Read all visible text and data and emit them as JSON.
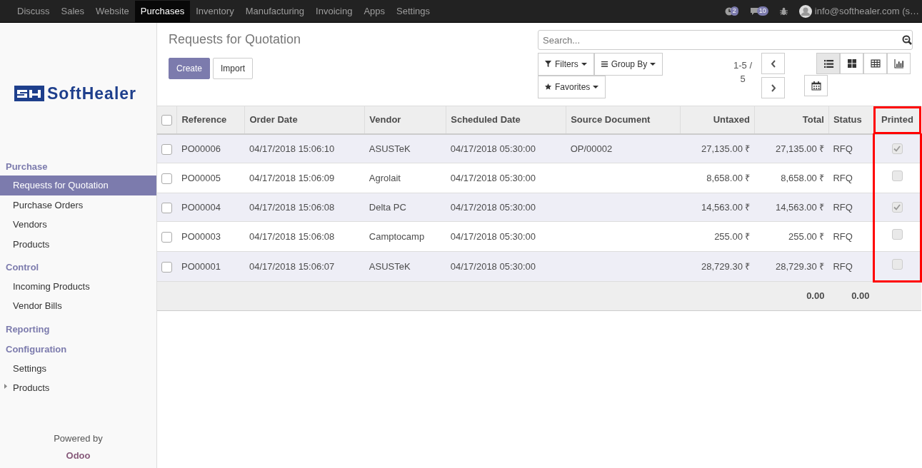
{
  "top_menu": [
    {
      "label": "Discuss",
      "selected": false
    },
    {
      "label": "Sales",
      "selected": false
    },
    {
      "label": "Website",
      "selected": false
    },
    {
      "label": "Purchases",
      "selected": true
    },
    {
      "label": "Inventory",
      "selected": false
    },
    {
      "label": "Manufacturing",
      "selected": false
    },
    {
      "label": "Invoicing",
      "selected": false
    },
    {
      "label": "Apps",
      "selected": false
    },
    {
      "label": "Settings",
      "selected": false
    }
  ],
  "systray": {
    "activities_count": "2",
    "messages_count": "10",
    "user": "info@softhealer.com (s…"
  },
  "sidebar": {
    "logo_text": "SoftHealer",
    "sections": [
      {
        "title": "Purchase",
        "items": [
          {
            "label": "Requests for Quotation",
            "selected": true
          },
          {
            "label": "Purchase Orders",
            "selected": false
          },
          {
            "label": "Vendors",
            "selected": false
          },
          {
            "label": "Products",
            "selected": false
          }
        ]
      },
      {
        "title": "Control",
        "items": [
          {
            "label": "Incoming Products",
            "selected": false
          },
          {
            "label": "Vendor Bills",
            "selected": false
          }
        ]
      },
      {
        "title": "Reporting"
      },
      {
        "title": "Configuration",
        "items": [
          {
            "label": "Settings",
            "selected": false
          },
          {
            "label": "Products",
            "selected": false,
            "expandable": true
          }
        ]
      }
    ],
    "footer": {
      "prefix": "Powered by",
      "brand": "Odoo"
    }
  },
  "control_panel": {
    "title": "Requests for Quotation",
    "buttons": [
      {
        "label": "Create",
        "kind": "primary"
      },
      {
        "label": "Import",
        "kind": "secondary"
      }
    ],
    "search": {
      "placeholder": "Search..."
    },
    "filters": [
      {
        "label": "Filters",
        "kind": "filter"
      },
      {
        "label": "Group By",
        "kind": "group"
      },
      {
        "label": "Favorites",
        "kind": "star"
      }
    ],
    "pager": "1-5 / 5",
    "views": [
      {
        "kind": "list",
        "selected": true
      },
      {
        "kind": "kanban",
        "selected": false
      },
      {
        "kind": "pivot",
        "selected": false
      },
      {
        "kind": "graph",
        "selected": false
      },
      {
        "kind": "calendar",
        "selected": false
      }
    ]
  },
  "table": {
    "all_selected": false,
    "columns": [
      {
        "label": "Reference",
        "kind": "text",
        "highlighted": false
      },
      {
        "label": "Order Date",
        "kind": "text",
        "highlighted": false
      },
      {
        "label": "Vendor",
        "kind": "text",
        "highlighted": false
      },
      {
        "label": "Scheduled Date",
        "kind": "text",
        "highlighted": false
      },
      {
        "label": "Source Document",
        "kind": "text",
        "highlighted": false
      },
      {
        "label": "Untaxed",
        "kind": "amount",
        "highlighted": false
      },
      {
        "label": "Total",
        "kind": "amount",
        "highlighted": false
      },
      {
        "label": "Status",
        "kind": "text",
        "highlighted": false
      },
      {
        "label": "Printed",
        "kind": "flag",
        "highlighted": true
      }
    ],
    "rows": [
      {
        "cells": [
          "PO00006",
          "04/17/2018 15:06:10",
          "ASUSTeK",
          "04/17/2018 05:30:00",
          "OP/00002",
          "27,135.00 ₹",
          "27,135.00 ₹",
          "RFQ"
        ],
        "printed": true,
        "selected": false
      },
      {
        "cells": [
          "PO00005",
          "04/17/2018 15:06:09",
          "Agrolait",
          "04/17/2018 05:30:00",
          "",
          "8,658.00 ₹",
          "8,658.00 ₹",
          "RFQ"
        ],
        "printed": false,
        "selected": false
      },
      {
        "cells": [
          "PO00004",
          "04/17/2018 15:06:08",
          "Delta PC",
          "04/17/2018 05:30:00",
          "",
          "14,563.00 ₹",
          "14,563.00 ₹",
          "RFQ"
        ],
        "printed": true,
        "selected": false
      },
      {
        "cells": [
          "PO00003",
          "04/17/2018 15:06:08",
          "Camptocamp",
          "04/17/2018 05:30:00",
          "",
          "255.00 ₹",
          "255.00 ₹",
          "RFQ"
        ],
        "printed": false,
        "selected": false
      },
      {
        "cells": [
          "PO00001",
          "04/17/2018 15:06:07",
          "ASUSTeK",
          "04/17/2018 05:30:00",
          "",
          "28,729.30 ₹",
          "28,729.30 ₹",
          "RFQ"
        ],
        "printed": false,
        "selected": false
      }
    ],
    "totals": [
      "0.00",
      "0.00"
    ]
  }
}
